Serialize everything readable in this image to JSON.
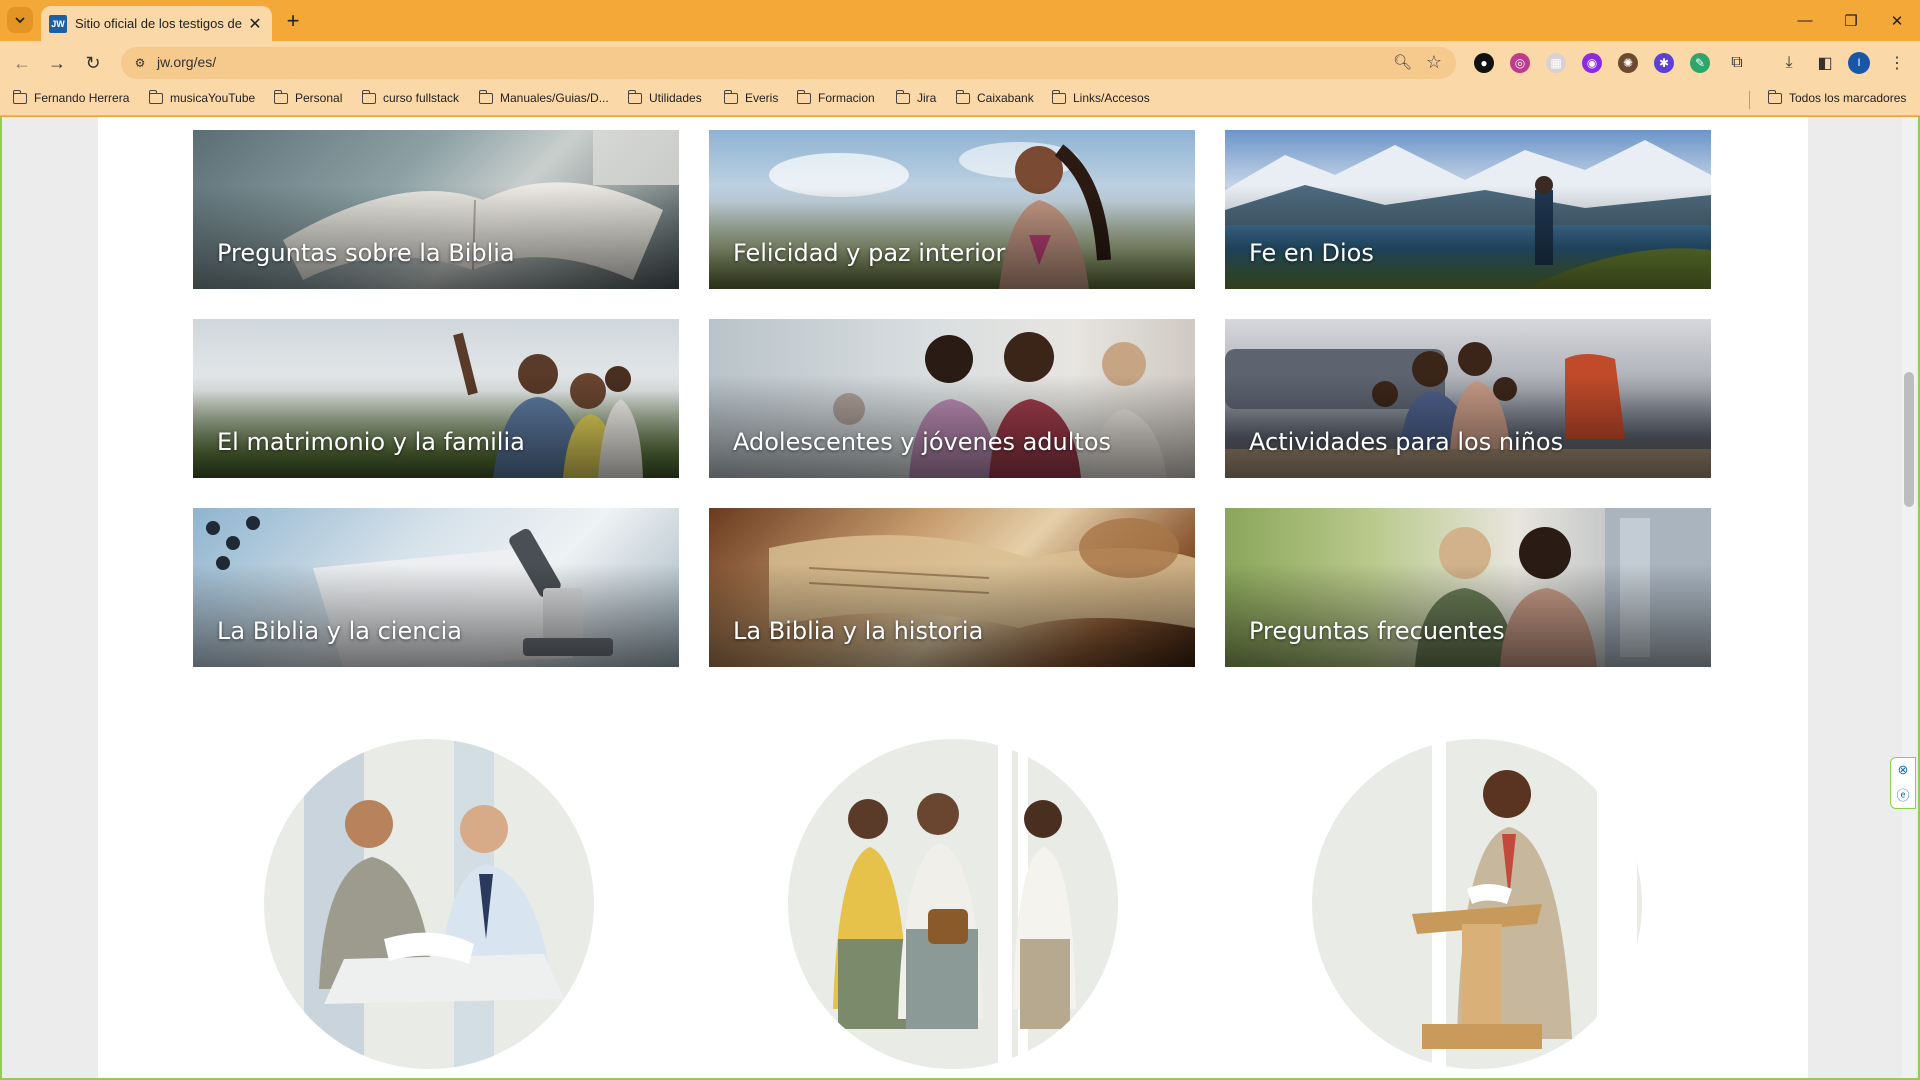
{
  "browser": {
    "tab": {
      "favicon_text": "JW",
      "title": "Sitio oficial de los testigos de Je"
    },
    "address": {
      "url": "jw.org/es/"
    },
    "bookmarks": [
      "Fernando Herrera",
      "musicaYouTube",
      "Personal",
      "curso fullstack",
      "Manuales/Guias/D...",
      "Utilidades",
      "Everis",
      "Formacion",
      "Jira",
      "Caixabank",
      "Links/Accesos"
    ],
    "all_bookmarks": "Todos los marcadores",
    "profile_initial": "I"
  },
  "topics": [
    {
      "label": "Preguntas sobre la Biblia"
    },
    {
      "label": "Felicidad y paz interior"
    },
    {
      "label": "Fe en Dios"
    },
    {
      "label": "El matrimonio y la familia"
    },
    {
      "label": "Adolescentes y jóvenes adultos"
    },
    {
      "label": "Actividades para los niños"
    },
    {
      "label": "La Biblia y la ciencia"
    },
    {
      "label": "La Biblia y la historia"
    },
    {
      "label": "Preguntas frecuentes"
    }
  ]
}
